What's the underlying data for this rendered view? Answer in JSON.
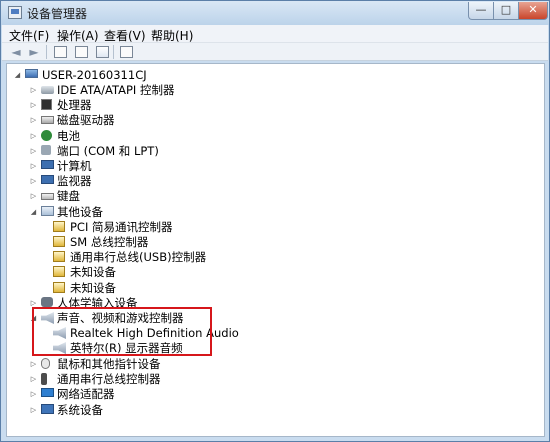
{
  "window": {
    "title": "设备管理器",
    "controls": {
      "minimize": "—",
      "maximize": "□",
      "close": "✕"
    }
  },
  "menu": {
    "file": "文件(F)",
    "action": "操作(A)",
    "view": "查看(V)",
    "help": "帮助(H)"
  },
  "toolbar": {
    "back": "◄",
    "forward": "►"
  },
  "tree": {
    "root": "USER-20160311CJ",
    "categories": {
      "ide": "IDE ATA/ATAPI 控制器",
      "cpu": "处理器",
      "disk": "磁盘驱动器",
      "battery": "电池",
      "ports": "端口 (COM 和 LPT)",
      "computer": "计算机",
      "monitor": "监视器",
      "keyboard": "键盘",
      "other": "其他设备",
      "hid": "人体学输入设备",
      "sound": "声音、视频和游戏控制器",
      "mouse": "鼠标和其他指针设备",
      "usb": "通用串行总线控制器",
      "network": "网络适配器",
      "system": "系统设备"
    },
    "other_children": [
      "PCI 简易通讯控制器",
      "SM 总线控制器",
      "通用串行总线(USB)控制器",
      "未知设备",
      "未知设备"
    ],
    "sound_children": [
      "Realtek High Definition Audio",
      "英特尔(R) 显示器音频"
    ],
    "expander_collapsed": "▷",
    "expander_expanded": "◢"
  },
  "colors": {
    "highlight_border": "#d6171b",
    "title_gradient_top": "#d9e7f5"
  }
}
